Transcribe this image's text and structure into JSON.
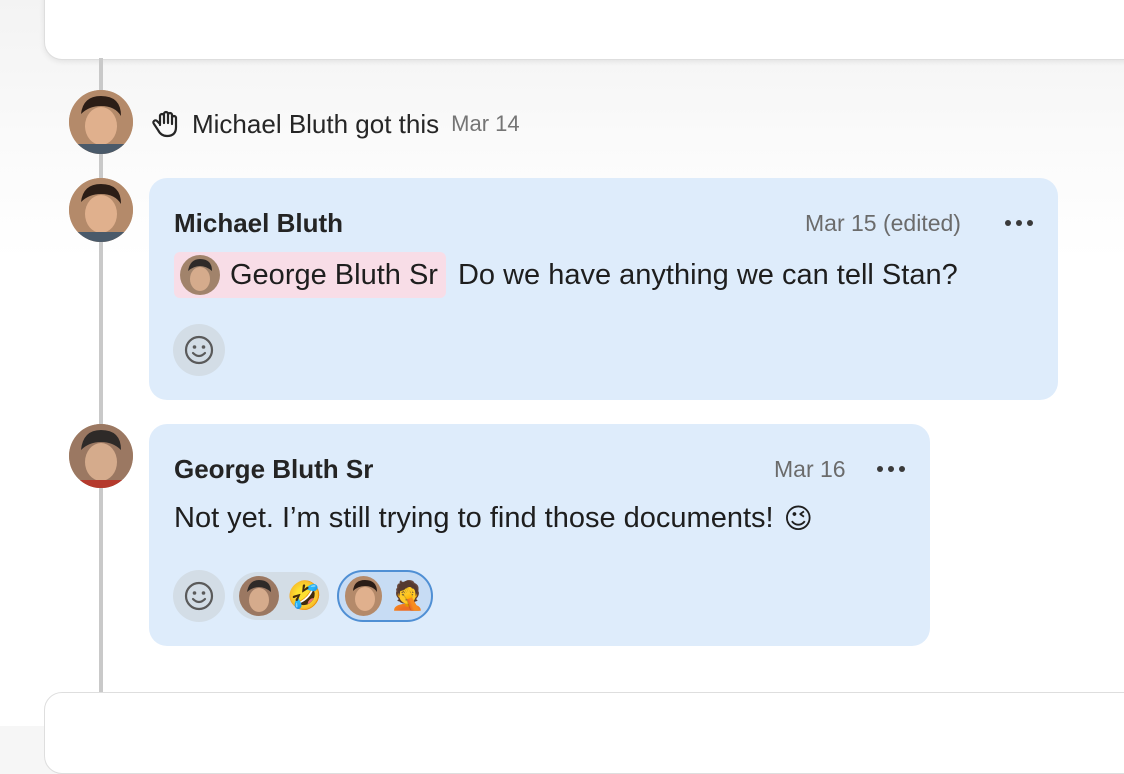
{
  "event": {
    "icon": "hand-icon",
    "text": "Michael Bluth got this",
    "date": "Mar 14"
  },
  "comments": [
    {
      "author": "Michael Bluth",
      "date": "Mar 15 (edited)",
      "mention": "George Bluth Sr",
      "message": "Do we have anything we can tell Stan?",
      "reactions": []
    },
    {
      "author": "George Bluth Sr",
      "date": "Mar 16",
      "message": "Not yet. I’m still trying to find those documents!",
      "message_emoji": "😉",
      "reactions": [
        {
          "by": "George Bluth Sr",
          "emoji": "🤣",
          "selected": false
        },
        {
          "by": "Michael Bluth",
          "emoji": "🤦",
          "selected": true
        }
      ]
    }
  ],
  "colors": {
    "bubble": "#deecfb",
    "mention": "#f8dde7",
    "selected_border": "#4f8fd4"
  }
}
